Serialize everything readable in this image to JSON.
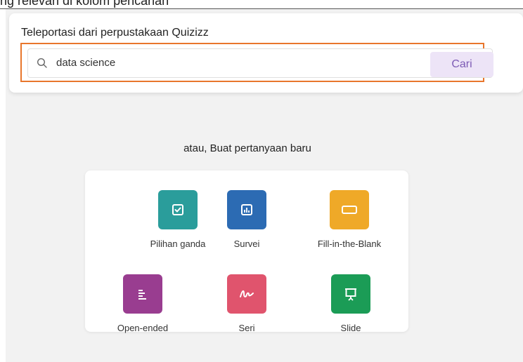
{
  "caption": "ng relevan di kolom pencarian",
  "search": {
    "title": "Teleportasi dari perpustakaan Quizizz",
    "value": "data science",
    "button_label": "Cari",
    "icon": "search-icon"
  },
  "create": {
    "prompt": "atau, Buat pertanyaan baru",
    "types": [
      {
        "label": "Pilihan ganda",
        "icon": "checkbox-icon",
        "color": "#2a9d9b"
      },
      {
        "label": "Survei",
        "icon": "bar-chart-icon",
        "color": "#2c6bb3"
      },
      {
        "label": "Fill-in-the-Blank",
        "icon": "blank-box-icon",
        "color": "#efa928"
      },
      {
        "label": "Open-ended",
        "icon": "text-lines-icon",
        "color": "#993d90"
      },
      {
        "label": "Seri",
        "icon": "scribble-icon",
        "color": "#e0546d"
      },
      {
        "label": "Slide",
        "icon": "presentation-icon",
        "color": "#1b9c56"
      }
    ]
  },
  "colors": {
    "highlight_border": "#e8762c",
    "button_bg": "#ede4f7",
    "button_text": "#7d5bb5",
    "page_bg": "#f2f2f2"
  }
}
